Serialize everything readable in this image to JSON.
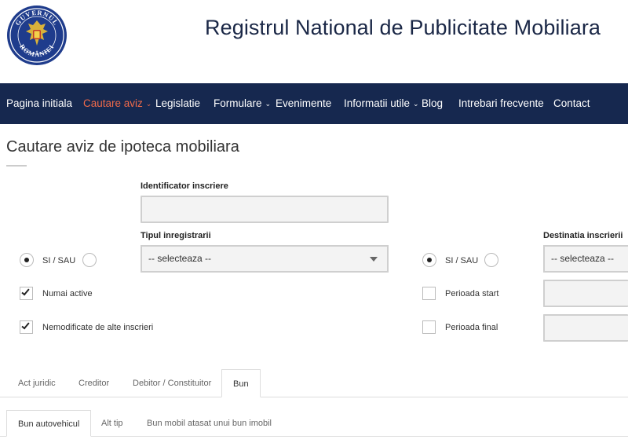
{
  "header": {
    "logo_text_top": "GUVERNUL",
    "logo_text_bottom": "ROMÂNIEI",
    "title": "Registrul National de Publicitate Mobiliara"
  },
  "nav": {
    "items": [
      {
        "label": "Pagina initiala",
        "dropdown": false
      },
      {
        "label": "Cautare aviz",
        "dropdown": true,
        "active": true
      },
      {
        "label": "Legislatie",
        "dropdown": false
      },
      {
        "label": "Formulare",
        "dropdown": true
      },
      {
        "label": "Evenimente",
        "dropdown": false
      },
      {
        "label": "Informatii utile",
        "dropdown": true
      },
      {
        "label": "Blog",
        "dropdown": false
      },
      {
        "label": "Intrebari frecvente",
        "dropdown": false
      },
      {
        "label": "Contact",
        "dropdown": false
      }
    ]
  },
  "page": {
    "title": "Cautare aviz de ipoteca mobiliara"
  },
  "form": {
    "identificator_label": "Identificator inscriere",
    "identificator_value": "",
    "tip_label": "Tipul inregistrarii",
    "tip_value": "-- selecteaza --",
    "destinatia_label": "Destinatia inscrierii",
    "destinatia_value": "-- selecteaza --",
    "left_radio_label": "SI / SAU",
    "right_radio_label": "SI / SAU",
    "numai_active_label": "Numai active",
    "numai_active_checked": true,
    "nemodificate_label": "Nemodificate de alte inscrieri",
    "nemodificate_checked": true,
    "perioada_start_label": "Perioada start",
    "perioada_start_checked": false,
    "perioada_final_label": "Perioada final",
    "perioada_final_checked": false
  },
  "tabs": [
    {
      "label": "Act juridic"
    },
    {
      "label": "Creditor"
    },
    {
      "label": "Debitor / Constituitor"
    },
    {
      "label": "Bun",
      "active": true
    }
  ],
  "subtabs": [
    {
      "label": "Bun autovehicul",
      "active": true
    },
    {
      "label": "Alt tip"
    },
    {
      "label": "Bun mobil atasat unui bun imobil"
    }
  ],
  "colors": {
    "nav_bg": "#16284f",
    "nav_active": "#ef6a4a",
    "title_color": "#1a2746",
    "logo_blue": "#1f3c8c",
    "logo_gold": "#d9b23a"
  }
}
